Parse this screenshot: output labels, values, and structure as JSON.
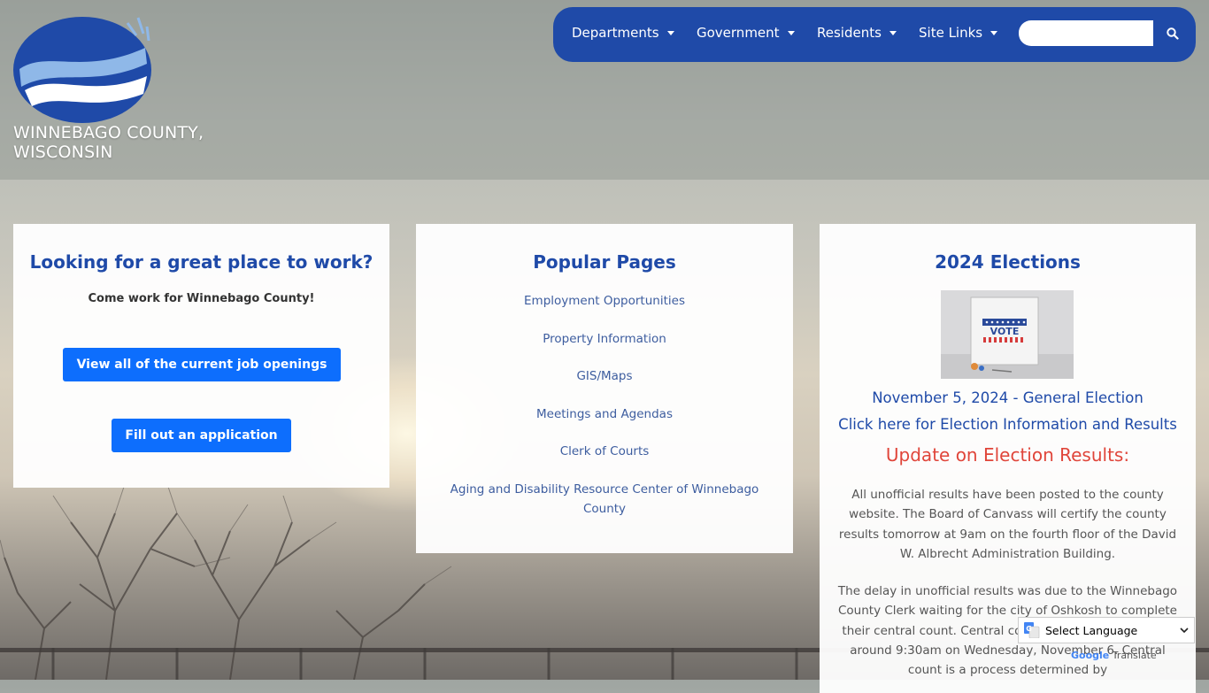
{
  "site": {
    "title_line1": "WINNEBAGO COUNTY,",
    "title_line2": "WISCONSIN"
  },
  "nav": {
    "items": [
      {
        "label": "Departments"
      },
      {
        "label": "Government"
      },
      {
        "label": "Residents"
      },
      {
        "label": "Site Links"
      }
    ],
    "search_placeholder": "",
    "search_icon": "search-icon"
  },
  "work_card": {
    "title": "Looking for a great place to work?",
    "subtitle": "Come work for Winnebago County!",
    "jobs_button": "View all of the current job openings",
    "apply_button": "Fill out an application"
  },
  "popular": {
    "title": "Popular Pages",
    "links": [
      "Employment Opportunities",
      "Property Information",
      "GIS/Maps",
      "Meetings and Agendas",
      "Clerk of Courts",
      "Aging and Disability Resource Center of Winnebago County"
    ]
  },
  "elections": {
    "title": "2024 Elections",
    "vote_sign": "VOTE",
    "date_line": "November 5, 2024 - General Election",
    "info_link": "Click here for Election Information and Results",
    "update_heading": "Update on Election Results:",
    "paragraph1": "All unofficial results have been posted to the county website. The Board of Canvass will certify the county results tomorrow at 9am on the fourth floor of the David W. Albrecht Administration Building.",
    "paragraph2": "The delay in unofficial results was due to the Winnebago County Clerk waiting for the city of Oshkosh to complete their central count. Central count tabulation completed around 9:30am on Wednesday, November 6.  Central count is a process determined by"
  },
  "translate": {
    "select_label": "Select Language",
    "powered_brand": "Google",
    "powered_text": "Translate"
  },
  "colors": {
    "nav_bg": "#1f4aa8",
    "button_bg": "#0d6efd",
    "heading": "#1f4aa8",
    "update_red": "#e0453a"
  }
}
